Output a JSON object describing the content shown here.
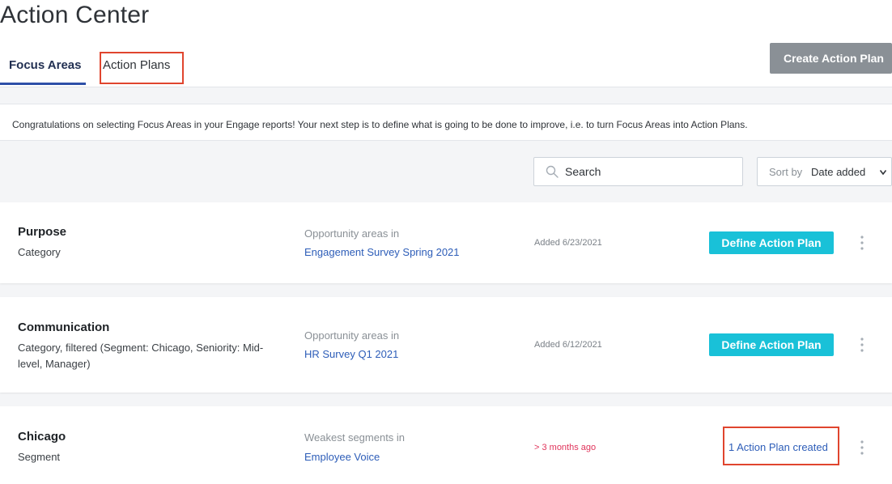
{
  "page": {
    "title": "Action Center"
  },
  "tabs": [
    {
      "label": "Focus Areas",
      "active": true
    },
    {
      "label": "Action Plans",
      "active": false
    }
  ],
  "create_button": {
    "label": "Create Action Plan"
  },
  "notice": {
    "text": "Congratulations on selecting Focus Areas in your Engage reports! Your next step is to define what is going to be done to improve, i.e. to turn Focus Areas into Action Plans."
  },
  "search": {
    "placeholder": "Search",
    "icon": "search-icon"
  },
  "sort": {
    "label": "Sort by",
    "value": "Date added",
    "icon": "chevron-down-icon"
  },
  "colors": {
    "accent": "#19c1d8",
    "link": "#2d5db8",
    "warning": "#e0345b",
    "create_button": "#8a9096",
    "tab_active": "#2d4fa8",
    "highlight": "#e0452e"
  },
  "focus_areas": [
    {
      "title": "Purpose",
      "subtitle": "Category",
      "source_label": "Opportunity areas in",
      "source_link": "Engagement Survey Spring 2021",
      "date": "Added 6/23/2021",
      "action": "Define Action Plan"
    },
    {
      "title": "Communication",
      "subtitle": "Category, filtered (Segment: Chicago, Seniority: Mid-level, Manager)",
      "source_label": "Opportunity areas in",
      "source_link": "HR Survey Q1 2021",
      "date": "Added 6/12/2021",
      "action": "Define Action Plan"
    },
    {
      "title": "Chicago",
      "subtitle": "Segment",
      "source_label": "Weakest segments in",
      "source_link": "Employee Voice",
      "date": "> 3 months ago",
      "action": "1 Action Plan created"
    }
  ]
}
